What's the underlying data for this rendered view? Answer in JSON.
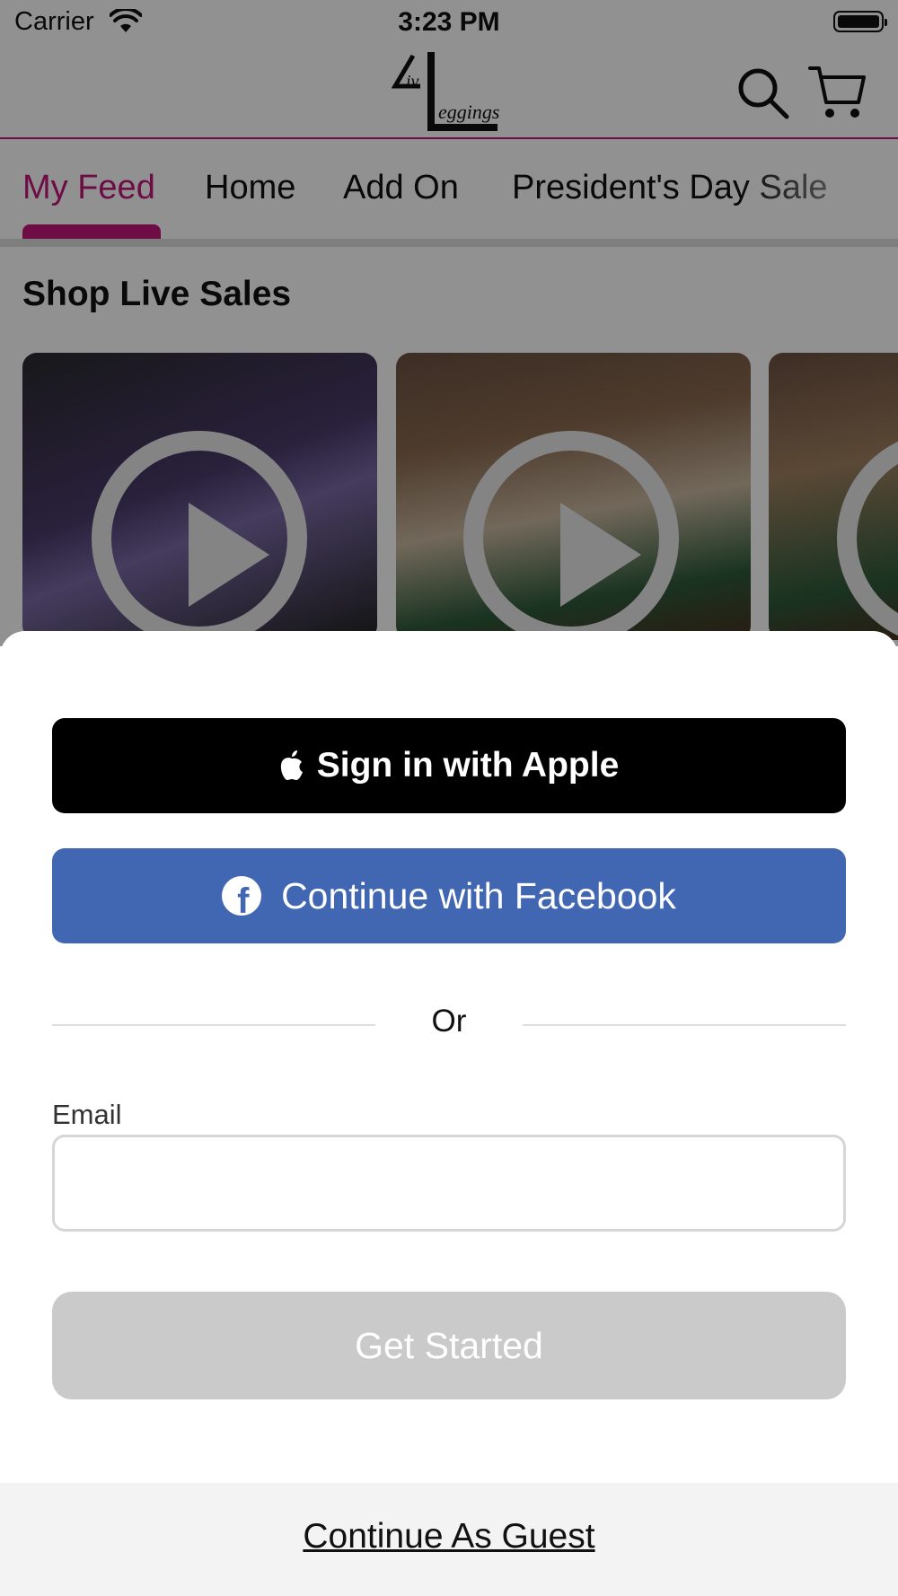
{
  "status_bar": {
    "carrier": "Carrier",
    "time": "3:23 PM"
  },
  "header": {
    "logo_text_top": "iv",
    "logo_text_bottom": "eggings"
  },
  "tabs": [
    {
      "label": "My Feed",
      "active": true
    },
    {
      "label": "Home",
      "active": false
    },
    {
      "label": "Add On",
      "active": false
    },
    {
      "label": "President's Day Sale",
      "active": false
    }
  ],
  "section": {
    "title": "Shop Live Sales"
  },
  "sheet": {
    "apple_label": "Sign in with Apple",
    "facebook_label": "Continue with Facebook",
    "or_label": "Or",
    "email_label": "Email",
    "email_value": "",
    "email_placeholder": "",
    "get_started_label": "Get Started",
    "guest_label": "Continue As Guest"
  },
  "colors": {
    "accent": "#c2187a",
    "facebook": "#4267b2",
    "apple": "#000000",
    "disabled": "#cacaca"
  }
}
